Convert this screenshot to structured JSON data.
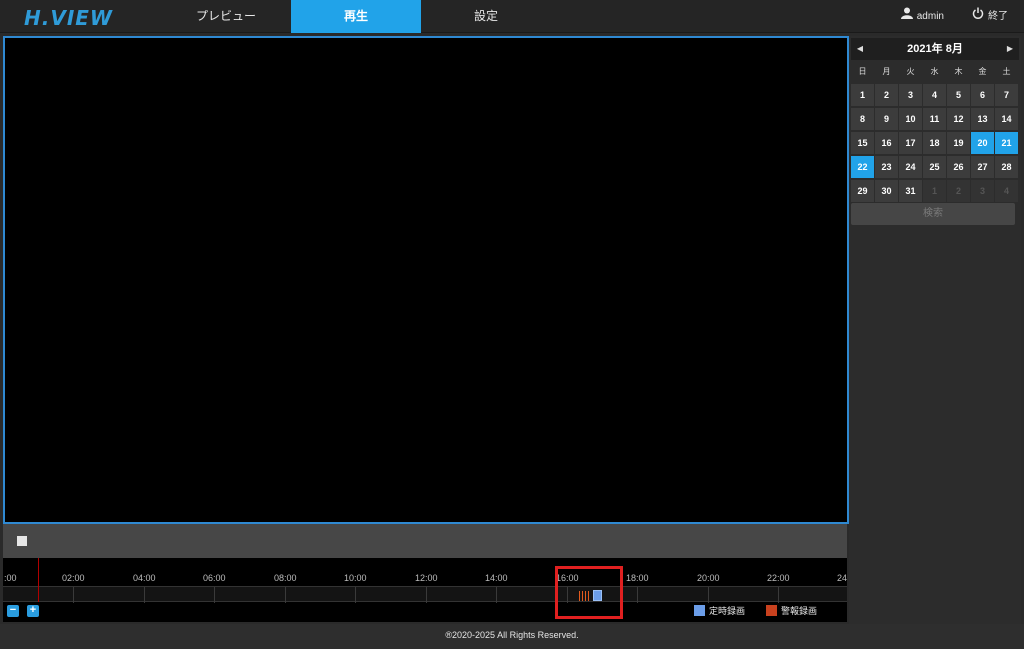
{
  "header": {
    "logo": "H.VIEW",
    "tabs": [
      {
        "label": "プレビュー",
        "active": false
      },
      {
        "label": "再生",
        "active": true
      },
      {
        "label": "設定",
        "active": false
      }
    ],
    "user": "admin",
    "logout": "終了"
  },
  "timeline": {
    "tick_labels": [
      ":00",
      "02:00",
      "04:00",
      "06:00",
      "08:00",
      "10:00",
      "12:00",
      "14:00",
      "16:00",
      "18:00",
      "20:00",
      "22:00",
      "24"
    ],
    "legend": [
      {
        "label": "定時録画",
        "color": "#6b9de8"
      },
      {
        "label": "警報録画",
        "color": "#c8411e"
      }
    ]
  },
  "calendar": {
    "title": "2021年 8月",
    "weekdays": [
      "日",
      "月",
      "火",
      "水",
      "木",
      "金",
      "土"
    ],
    "days": [
      [
        "1",
        "2",
        "3",
        "4",
        "5",
        "6",
        "7"
      ],
      [
        "8",
        "9",
        "10",
        "11",
        "12",
        "13",
        "14"
      ],
      [
        "15",
        "16",
        "17",
        "18",
        "19",
        "20",
        "21"
      ],
      [
        "22",
        "23",
        "24",
        "25",
        "26",
        "27",
        "28"
      ],
      [
        "29",
        "30",
        "31",
        "1",
        "2",
        "3",
        "4"
      ]
    ],
    "highlighted": [
      "20",
      "21",
      "22"
    ],
    "search_label": "検索"
  },
  "footer": {
    "copyright": "®2020-2025 All Rights Reserved."
  },
  "colors": {
    "accent": "#21a3e9",
    "highlight_box": "#e02020"
  }
}
